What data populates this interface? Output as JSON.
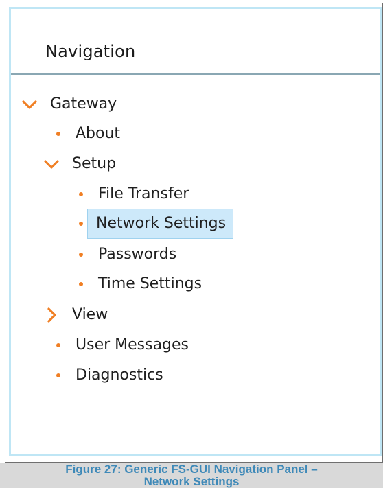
{
  "panel": {
    "title": "Navigation"
  },
  "tree": {
    "gateway": {
      "label": "Gateway",
      "icon": "chevron-down-icon"
    },
    "about": {
      "label": "About"
    },
    "setup": {
      "label": "Setup",
      "icon": "chevron-down-icon"
    },
    "file_transfer": {
      "label": "File Transfer"
    },
    "network_settings": {
      "label": "Network Settings",
      "selected": true
    },
    "passwords": {
      "label": "Passwords"
    },
    "time_settings": {
      "label": "Time Settings"
    },
    "view": {
      "label": "View",
      "icon": "chevron-right-icon"
    },
    "user_messages": {
      "label": "User Messages"
    },
    "diagnostics": {
      "label": "Diagnostics"
    }
  },
  "colors": {
    "accent_orange": "#f07f24",
    "selection_bg": "#cde9fa",
    "panel_border": "#bfe6f5",
    "caption_text": "#3e89b8"
  },
  "caption": {
    "line1": "Figure 27: Generic FS-GUI Navigation Panel –",
    "line2": "Network Settings"
  }
}
